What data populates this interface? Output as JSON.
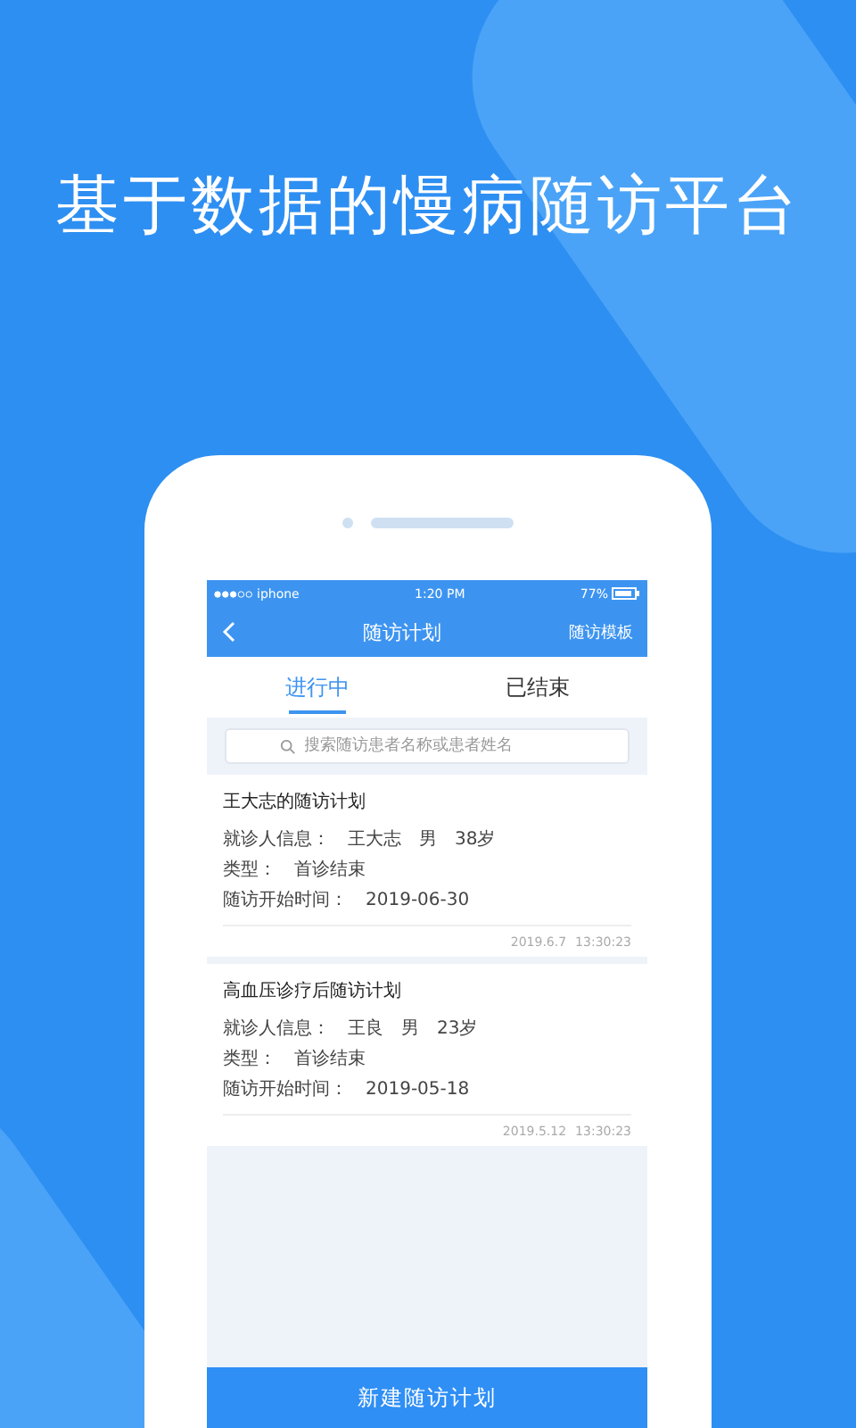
{
  "headline": "基于数据的慢病随访平台",
  "status_bar": {
    "carrier": "iphone",
    "time": "1:20 PM",
    "battery": "77%"
  },
  "nav": {
    "title": "随访计划",
    "action": "随访模板"
  },
  "tabs": [
    {
      "label": "进行中",
      "selected": true
    },
    {
      "label": "已结束",
      "selected": false
    }
  ],
  "search": {
    "placeholder": "搜索随访患者名称或患者姓名"
  },
  "plans": [
    {
      "title": "王大志的随访计划",
      "patient_label": "就诊人信息：",
      "patient": [
        "王大志",
        "男",
        "38岁"
      ],
      "type_label": "类型：",
      "type": "首诊结束",
      "start_label": "随访开始时间：",
      "start": "2019-06-30",
      "date": "2019.6.7",
      "time": "13:30:23"
    },
    {
      "title": "高血压诊疗后随访计划",
      "patient_label": "就诊人信息：",
      "patient": [
        "王良",
        "男",
        "23岁"
      ],
      "type_label": "类型：",
      "type": "首诊结束",
      "start_label": "随访开始时间：",
      "start": "2019-05-18",
      "date": "2019.5.12",
      "time": "13:30:23"
    }
  ],
  "button": "新建随访计划"
}
